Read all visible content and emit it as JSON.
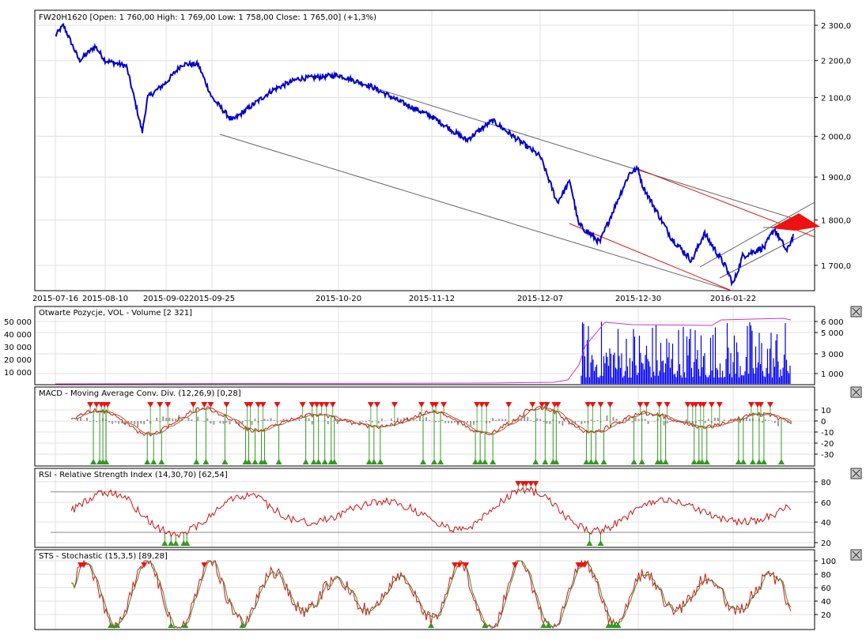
{
  "chart_data": {
    "type": "line",
    "title": "FW20H1620 [Open: 1 760,00  High: 1 769,00  Low: 1 758,00  Close: 1 765,00] (+1,3%)",
    "x_ticks": [
      "2015-07-16",
      "2015-08-10",
      "2015-09-02",
      "2015-09-25",
      "2015-10-20",
      "2015-11-12",
      "2015-12-07",
      "2015-12-30",
      "2016-01-22"
    ],
    "price_axis": {
      "scale": "log",
      "ticks": [
        "2 300,0",
        "2 200,0",
        "2 100,0",
        "2 000,0",
        "1 900,0",
        "1 800,0",
        "1 700,0"
      ],
      "tick_values": [
        2300,
        2200,
        2100,
        2000,
        1900,
        1800,
        1700
      ],
      "ylim": [
        1640,
        2330
      ]
    },
    "price_series": {
      "name": "FW20H1620",
      "color": "#0000cc",
      "points": [
        [
          "2015-07-16",
          2270
        ],
        [
          "2015-07-20",
          2300
        ],
        [
          "2015-07-28",
          2200
        ],
        [
          "2015-08-05",
          2240
        ],
        [
          "2015-08-10",
          2200
        ],
        [
          "2015-08-18",
          2185
        ],
        [
          "2015-08-24",
          2010
        ],
        [
          "2015-08-26",
          2100
        ],
        [
          "2015-09-02",
          2140
        ],
        [
          "2015-09-10",
          2190
        ],
        [
          "2015-09-18",
          2190
        ],
        [
          "2015-09-25",
          2100
        ],
        [
          "2015-09-29",
          2040
        ],
        [
          "2015-10-07",
          2120
        ],
        [
          "2015-10-12",
          2150
        ],
        [
          "2015-10-20",
          2160
        ],
        [
          "2015-10-28",
          2130
        ],
        [
          "2015-11-04",
          2090
        ],
        [
          "2015-11-12",
          2050
        ],
        [
          "2015-11-20",
          1990
        ],
        [
          "2015-11-26",
          2040
        ],
        [
          "2015-12-02",
          1990
        ],
        [
          "2015-12-07",
          1950
        ],
        [
          "2015-12-11",
          1840
        ],
        [
          "2015-12-14",
          1890
        ],
        [
          "2015-12-16",
          1790
        ],
        [
          "2015-12-21",
          1750
        ],
        [
          "2015-12-28",
          1910
        ],
        [
          "2015-12-30",
          1920
        ],
        [
          "2015-12-31",
          1880
        ],
        [
          "2016-01-04",
          1810
        ],
        [
          "2016-01-07",
          1760
        ],
        [
          "2016-01-12",
          1710
        ],
        [
          "2016-01-15",
          1770
        ],
        [
          "2016-01-20",
          1700
        ],
        [
          "2016-01-22",
          1660
        ],
        [
          "2016-01-25",
          1720
        ],
        [
          "2016-02-01",
          1740
        ],
        [
          "2016-02-04",
          1780
        ],
        [
          "2016-02-08",
          1730
        ],
        [
          "2016-02-10",
          1765
        ]
      ]
    },
    "panels": [
      {
        "id": "volume",
        "title": "Otwarte Pozycje, VOL - Volume [2 321]",
        "left_ticks": [
          "50 000",
          "40 000",
          "30 000",
          "20 000",
          "10 000"
        ],
        "right_ticks": [
          "6 000",
          "5 000",
          "3 000",
          "1 000"
        ],
        "series": [
          {
            "name": "Otwarte Pozycje",
            "color": "#cc33cc"
          },
          {
            "name": "Volume",
            "color": "#0000ee",
            "last": 2321
          }
        ]
      },
      {
        "id": "macd",
        "title": "MACD - Moving Average Conv. Div. (12,26,9) [0,28]",
        "right_ticks": [
          "10",
          "0",
          "-10",
          "-20",
          "-30"
        ],
        "tick_values": [
          10,
          0,
          -10,
          -20,
          -30
        ],
        "params": [
          12,
          26,
          9
        ],
        "last": 0.28
      },
      {
        "id": "rsi",
        "title": "RSI - Relative Strength Index (14,30,70) [62,54]",
        "right_ticks": [
          "80",
          "60",
          "40",
          "20"
        ],
        "tick_values": [
          80,
          60,
          40,
          20
        ],
        "params": [
          14,
          30,
          70
        ],
        "last": 62.54
      },
      {
        "id": "sts",
        "title": "STS - Stochastic (15,3,5) [89,28]",
        "right_ticks": [
          "100",
          "80",
          "60",
          "40",
          "20"
        ],
        "tick_values": [
          100,
          80,
          60,
          40,
          20
        ],
        "params": [
          15,
          3,
          5
        ],
        "last": 89.28
      }
    ],
    "colors": {
      "signal_sell": "#ee1111",
      "signal_buy": "#339922",
      "trend": "#555555",
      "trend_red": "#dd1111"
    }
  }
}
